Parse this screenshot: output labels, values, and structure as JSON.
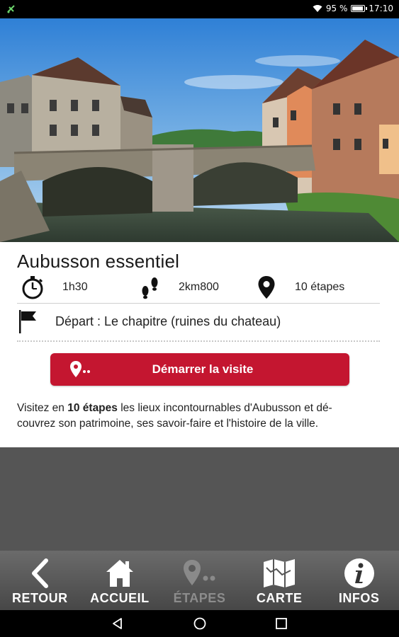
{
  "status_bar": {
    "battery_percent_text": "95 %",
    "battery_level": 0.95,
    "time": "17:10",
    "icons": [
      "notification-icon",
      "wifi-icon",
      "battery-icon"
    ]
  },
  "tour": {
    "title": "Aubusson essentiel",
    "duration": "1h30",
    "distance": "2km800",
    "steps": "10 étapes",
    "departure": "Départ : Le chapitre (ruines du chateau)",
    "cta_label": "Démarrer la visite",
    "description_pre": "Visitez en ",
    "description_bold": "10 étapes",
    "description_line1_post": " les lieux incontournables d'Aubusson et dé-",
    "description_line2": "couvrez son patrimoine, ses savoir-faire et l'histoire de la ville."
  },
  "bottom_nav": {
    "items": [
      {
        "label": "RETOUR",
        "icon": "chevron-left-icon",
        "enabled": true
      },
      {
        "label": "ACCUEIL",
        "icon": "home-icon",
        "enabled": true
      },
      {
        "label": "ÉTAPES",
        "icon": "pin-dots-icon",
        "enabled": false
      },
      {
        "label": "CARTE",
        "icon": "map-icon",
        "enabled": true
      },
      {
        "label": "INFOS",
        "icon": "info-icon",
        "enabled": true
      }
    ]
  },
  "colors": {
    "accent": "#c41630",
    "nav_background": "#555555",
    "grey_area": "#555555"
  }
}
